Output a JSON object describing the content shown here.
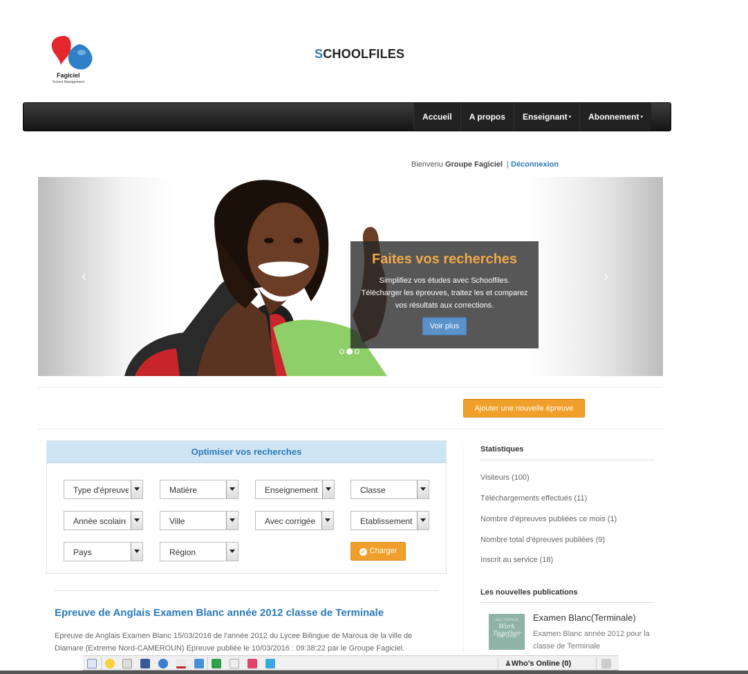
{
  "logo": {
    "brand": "Fagiciel",
    "tagline": "School Management"
  },
  "site": {
    "title_first": "S",
    "title_rest": "CHOOLFILES"
  },
  "nav": [
    {
      "label": "Accueil",
      "caret": ""
    },
    {
      "label": "A propos",
      "caret": ""
    },
    {
      "label": "Enseignant",
      "caret": "▾"
    },
    {
      "label": "Abonnement",
      "caret": "▾"
    }
  ],
  "welcome": {
    "prefix": "Bienvenu",
    "user": "Groupe Fagiciel",
    "separator": "|",
    "logout": "Déconnexion"
  },
  "carousel": {
    "prev": "‹",
    "next": "›",
    "caption_title": "Faites vos recherches",
    "caption_line1": "Simplifiez vos études avec Schoolfiles.",
    "caption_line2": "Télécharger les épreuves, traitez les et comparez",
    "caption_line3": "vos résultats aux corrections.",
    "button": "Voir plus",
    "active_slide": 2,
    "slide_count": 3
  },
  "add_button": "Ajouter une nouvelle épreuve",
  "search": {
    "title": "Optimiser vos recherches",
    "selects": [
      "Type d'épreuve",
      "Matière",
      "Enseignement",
      "Classe",
      "Année scolaire",
      "Ville",
      "Avec corrigée",
      "Etablissement",
      "Pays",
      "Région"
    ],
    "submit": "Charger"
  },
  "stats": {
    "title": "Statistiques",
    "items": [
      "Visiteurs (100)",
      "Téléchargements effectués (11)",
      "Nombre d'épreuves publiées ce mois (1)",
      "Nombre total d'épreuves publiées (9)",
      "Inscrit au service (18)"
    ]
  },
  "publications": {
    "title": "Les nouvelles publications",
    "thumb_top": "ALL THINGS",
    "thumb_mid": "Work Together",
    "thumb_bot": "FOR GOOD",
    "item_title": "Examen Blanc(Terminale)",
    "item_desc": "Examen Blanc année 2012 pour la classe de Terminale"
  },
  "article": {
    "title": "Epreuve de Anglais Examen Blanc année 2012 classe de Terminale",
    "body": "Epreuve de Anglais Examen Blanc 15/03/2016 de l'année 2012 du Lycee Bilingue de Maroua de la ville de Diamare (Extreme Nord-CAMEROUN) Epreuve publiée le 10/03/2016 : 09:38:22 par le Groupe Fagiciel."
  },
  "taskbar": {
    "whos_online": "Who's Online (0)"
  },
  "colors": {
    "accent": "#2a7ab8",
    "orange": "#f0a02a",
    "caption_title": "#f0a94a"
  }
}
